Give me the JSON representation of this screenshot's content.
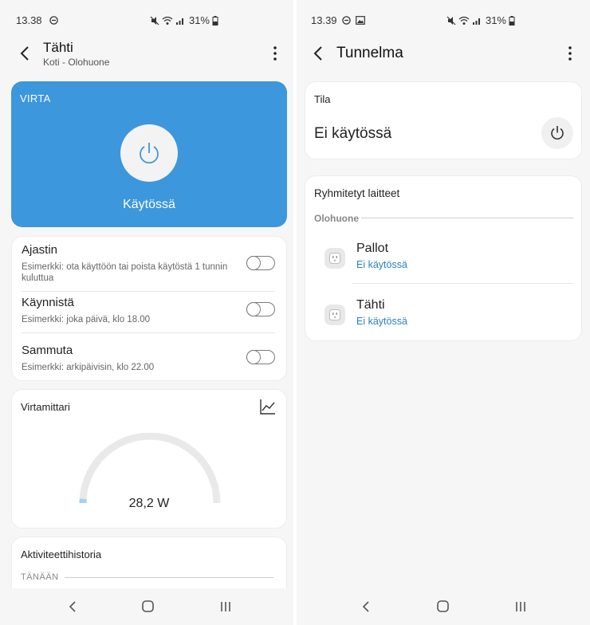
{
  "left": {
    "status": {
      "time": "13.38",
      "battery": "31%"
    },
    "header": {
      "title": "Tähti",
      "subtitle": "Koti - Olohuone"
    },
    "power": {
      "label": "VIRTA",
      "state": "Käytössä"
    },
    "schedules": [
      {
        "title": "Ajastin",
        "desc": "Esimerkki: ota käyttöön tai poista käytöstä 1 tunnin kuluttua",
        "on": false
      },
      {
        "title": "Käynnistä",
        "desc": "Esimerkki: joka päivä, klo 18.00",
        "on": false
      },
      {
        "title": "Sammuta",
        "desc": "Esimerkki: arkipäivisin, klo 22.00",
        "on": false
      }
    ],
    "meter": {
      "title": "Virtamittari",
      "value": "28,2 W",
      "gauge_fraction": 0.02
    },
    "history": {
      "title": "Aktiviteettihistoria",
      "section": "TÄNÄÄN"
    }
  },
  "right": {
    "status": {
      "time": "13.39",
      "battery": "31%"
    },
    "header": {
      "title": "Tunnelma"
    },
    "tila": {
      "label": "Tila",
      "value": "Ei käytössä"
    },
    "grouped": {
      "title": "Ryhmitetyt laitteet",
      "section": "Olohuone",
      "devices": [
        {
          "name": "Pallot",
          "status": "Ei käytössä"
        },
        {
          "name": "Tähti",
          "status": "Ei käytössä"
        }
      ]
    }
  },
  "colors": {
    "accent": "#3d97dc",
    "link": "#2b7fc4",
    "gauge_fill": "#9fd3ee"
  }
}
